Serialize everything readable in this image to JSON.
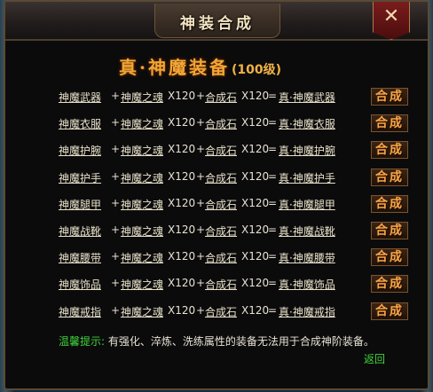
{
  "window": {
    "title": "神装合成",
    "close_icon": "close-icon"
  },
  "heading": {
    "main": "真·神魔装备",
    "sub": "(100级)"
  },
  "recipes": [
    {
      "base": "神魔武器",
      "plus1": "+",
      "mat1": "神魔之魂",
      "qty1": "X120",
      "plus2": "+",
      "mat2": "合成石",
      "qty2": "X120",
      "eq": "=",
      "result": "真·神魔武器",
      "button": "合成"
    },
    {
      "base": "神魔衣服",
      "plus1": "+",
      "mat1": "神魔之魂",
      "qty1": "X120",
      "plus2": "+",
      "mat2": "合成石",
      "qty2": "X120",
      "eq": "=",
      "result": "真·神魔衣服",
      "button": "合成"
    },
    {
      "base": "神魔护腕",
      "plus1": "+",
      "mat1": "神魔之魂",
      "qty1": "X120",
      "plus2": "+",
      "mat2": "合成石",
      "qty2": "X120",
      "eq": "=",
      "result": "真·神魔护腕",
      "button": "合成"
    },
    {
      "base": "神魔护手",
      "plus1": "+",
      "mat1": "神魔之魂",
      "qty1": "X120",
      "plus2": "+",
      "mat2": "合成石",
      "qty2": "X120",
      "eq": "=",
      "result": "真·神魔护手",
      "button": "合成"
    },
    {
      "base": "神魔腿甲",
      "plus1": "+",
      "mat1": "神魔之魂",
      "qty1": "X120",
      "plus2": "+",
      "mat2": "合成石",
      "qty2": "X120",
      "eq": "=",
      "result": "真·神魔腿甲",
      "button": "合成"
    },
    {
      "base": "神魔战靴",
      "plus1": "+",
      "mat1": "神魔之魂",
      "qty1": "X120",
      "plus2": "+",
      "mat2": "合成石",
      "qty2": "X120",
      "eq": "=",
      "result": "真·神魔战靴",
      "button": "合成"
    },
    {
      "base": "神魔腰带",
      "plus1": "+",
      "mat1": "神魔之魂",
      "qty1": "X120",
      "plus2": "+",
      "mat2": "合成石",
      "qty2": "X120",
      "eq": "=",
      "result": "真·神魔腰带",
      "button": "合成"
    },
    {
      "base": "神魔饰品",
      "plus1": "+",
      "mat1": "神魔之魂",
      "qty1": "X120",
      "plus2": "+",
      "mat2": "合成石",
      "qty2": "X120",
      "eq": "=",
      "result": "真·神魔饰品",
      "button": "合成"
    },
    {
      "base": "神魔戒指",
      "plus1": "+",
      "mat1": "神魔之魂",
      "qty1": "X120",
      "plus2": "+",
      "mat2": "合成石",
      "qty2": "X120",
      "eq": "=",
      "result": "真·神魔戒指",
      "button": "合成"
    }
  ],
  "hint": {
    "label": "温馨提示:",
    "text": "有强化、淬炼、洗练属性的装备无法用于合成神阶装备。"
  },
  "back_link": "返回",
  "colors": {
    "accent_orange": "#f0a637",
    "hint_green": "#3fd43a",
    "close_red": "#7a1c1c"
  }
}
